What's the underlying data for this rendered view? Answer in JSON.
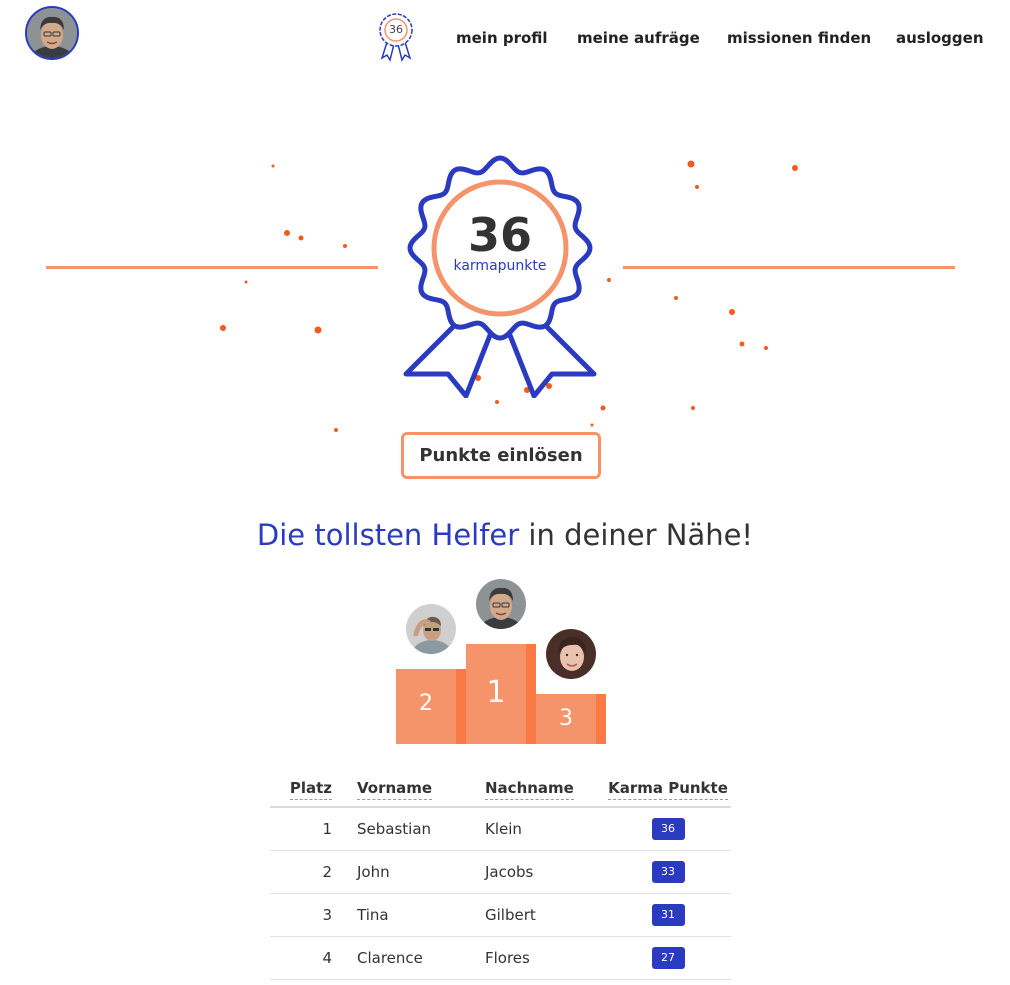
{
  "header": {
    "karma_badge": "36",
    "nav": [
      "mein profil",
      "meine aufräge",
      "missionen finden",
      "ausloggen"
    ]
  },
  "hero": {
    "points": "36",
    "label": "karmapunkte",
    "redeem_button": "Punkte einlösen"
  },
  "leaderboard": {
    "heading_accent": "Die tollsten Helfer",
    "heading_rest": " in deiner Nähe!",
    "podium": [
      "2",
      "1",
      "3"
    ],
    "columns": [
      "Platz",
      "Vorname",
      "Nachname",
      "Karma Punkte"
    ],
    "rows": [
      {
        "platz": "1",
        "vorname": "Sebastian",
        "nachname": "Klein",
        "karma": "36"
      },
      {
        "platz": "2",
        "vorname": "John",
        "nachname": "Jacobs",
        "karma": "33"
      },
      {
        "platz": "3",
        "vorname": "Tina",
        "nachname": "Gilbert",
        "karma": "31"
      },
      {
        "platz": "4",
        "vorname": "Clarence",
        "nachname": "Flores",
        "karma": "27"
      }
    ]
  },
  "colors": {
    "accent_blue": "#2b3bbf",
    "accent_orange": "#f5946b",
    "podium_shade": "#f97a45"
  }
}
